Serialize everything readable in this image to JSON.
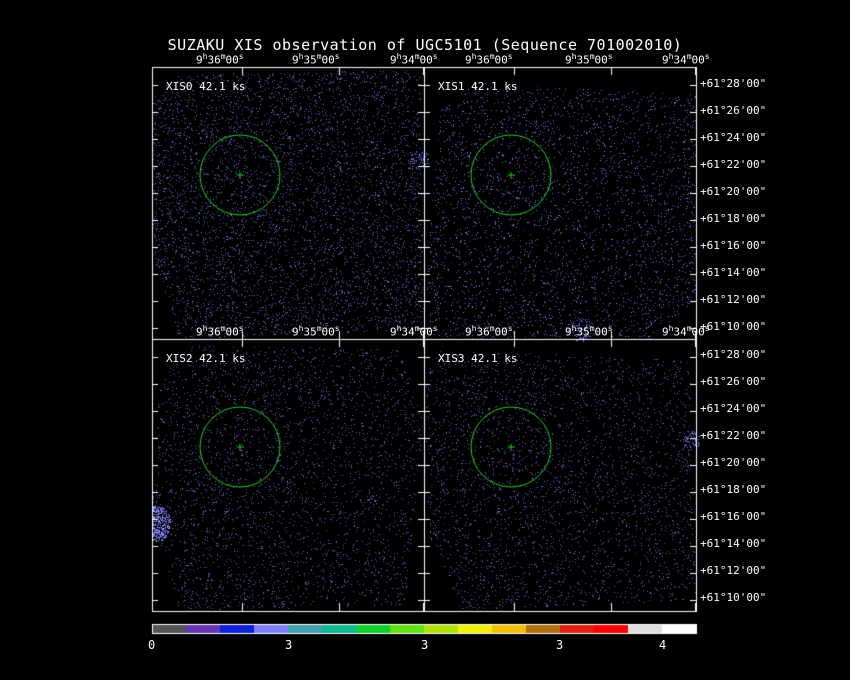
{
  "title": "SUZAKU XIS observation of UGC5101  (Sequence 701002010)",
  "panels": [
    {
      "label": "XIS0 42.1 ks",
      "color": "#7070e0"
    },
    {
      "label": "XIS1 42.1 ks",
      "color": "#7070e0"
    },
    {
      "label": "XIS2 42.1 ks",
      "color": "#7070e0"
    },
    {
      "label": "XIS3 42.1 ks",
      "color": "#7070e0"
    }
  ],
  "ra_ticks": [
    "9h36m00s",
    "9h35m00s",
    "9h34m00s"
  ],
  "dec_ticks": [
    "+61°28'00\"",
    "+61°26'00\"",
    "+61°24'00\"",
    "+61°22'00\"",
    "+61°20'00\"",
    "+61°18'00\"",
    "+61°16'00\"",
    "+61°14'00\"",
    "+61°12'00\"",
    "+61°10'00\""
  ],
  "source_region_color": "#22d022",
  "colorbar": {
    "ticks": [
      "0",
      "3",
      "3",
      "3",
      "4"
    ],
    "colors": [
      "#555555",
      "#6a35b5",
      "#1020d8",
      "#8080ff",
      "#40a0b0",
      "#10b890",
      "#10d030",
      "#60e010",
      "#b0e000",
      "#f0f000",
      "#f0c000",
      "#b07010",
      "#e02010",
      "#ff0000",
      "#e0e0e0",
      "#ffffff"
    ]
  }
}
